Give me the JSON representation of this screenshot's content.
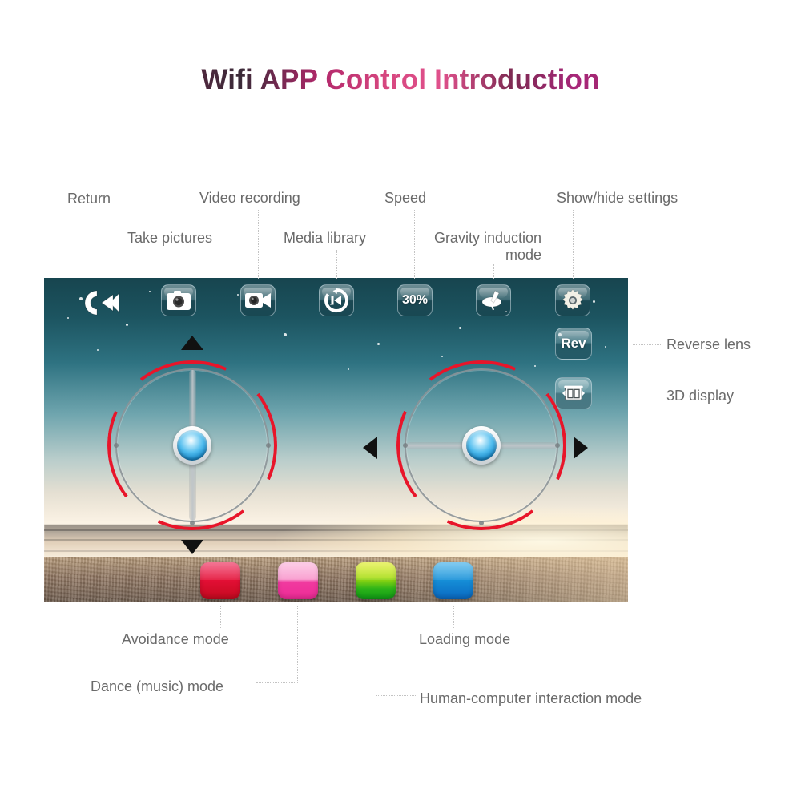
{
  "page": {
    "title": "Wifi APP Control Introduction",
    "title_gradient_from": "#7a2746",
    "title_gradient_to": "#b2286b"
  },
  "toolbar": {
    "items": [
      {
        "id": "return",
        "icon": "return-arrow-icon",
        "label": "Return",
        "value": ""
      },
      {
        "id": "take-pictures",
        "icon": "camera-icon",
        "label": "Take pictures",
        "value": ""
      },
      {
        "id": "video",
        "icon": "video-camera-icon",
        "label": "Video recording",
        "value": ""
      },
      {
        "id": "media-library",
        "icon": "media-library-icon",
        "label": "Media library",
        "value": ""
      },
      {
        "id": "speed",
        "icon": "speed-percent-icon",
        "label": "Speed",
        "value": "30%"
      },
      {
        "id": "gravity",
        "icon": "spinning-top-icon",
        "label": "Gravity induction\nmode",
        "value": ""
      },
      {
        "id": "settings",
        "icon": "gear-icon",
        "label": "Show/hide settings",
        "value": ""
      }
    ]
  },
  "side_buttons": [
    {
      "id": "reverse-lens",
      "icon": "rev-text-icon",
      "value": "Rev",
      "label": "Reverse lens"
    },
    {
      "id": "3d-display",
      "icon": "3d-panels-icon",
      "value": "",
      "label": "3D display"
    }
  ],
  "joysticks": {
    "left": {
      "name": "throttle-joystick",
      "axis": "vertical",
      "up_arrow": "triangle-up-icon",
      "down_arrow": "triangle-down-icon",
      "ring_color": "#e8152a",
      "knob_color": "#52bdee"
    },
    "right": {
      "name": "direction-joystick",
      "axis": "horizontal",
      "left_arrow": "triangle-left-icon",
      "right_arrow": "triangle-right-icon",
      "ring_color": "#e8152a",
      "knob_color": "#52bdee"
    }
  },
  "mode_buttons": [
    {
      "id": "avoidance",
      "color": "#e8103d",
      "color2": "#c00a22",
      "label": "Avoidance mode"
    },
    {
      "id": "dance",
      "color": "#f99cce",
      "color2": "#f0369f",
      "label": "Dance (music) mode"
    },
    {
      "id": "human",
      "color": "#d8e80c",
      "color2": "#0fa61c",
      "label": "Human-computer interaction mode"
    },
    {
      "id": "loading",
      "color": "#1b9ae0",
      "color2": "#0a66bf",
      "label": "Loading mode"
    }
  ]
}
